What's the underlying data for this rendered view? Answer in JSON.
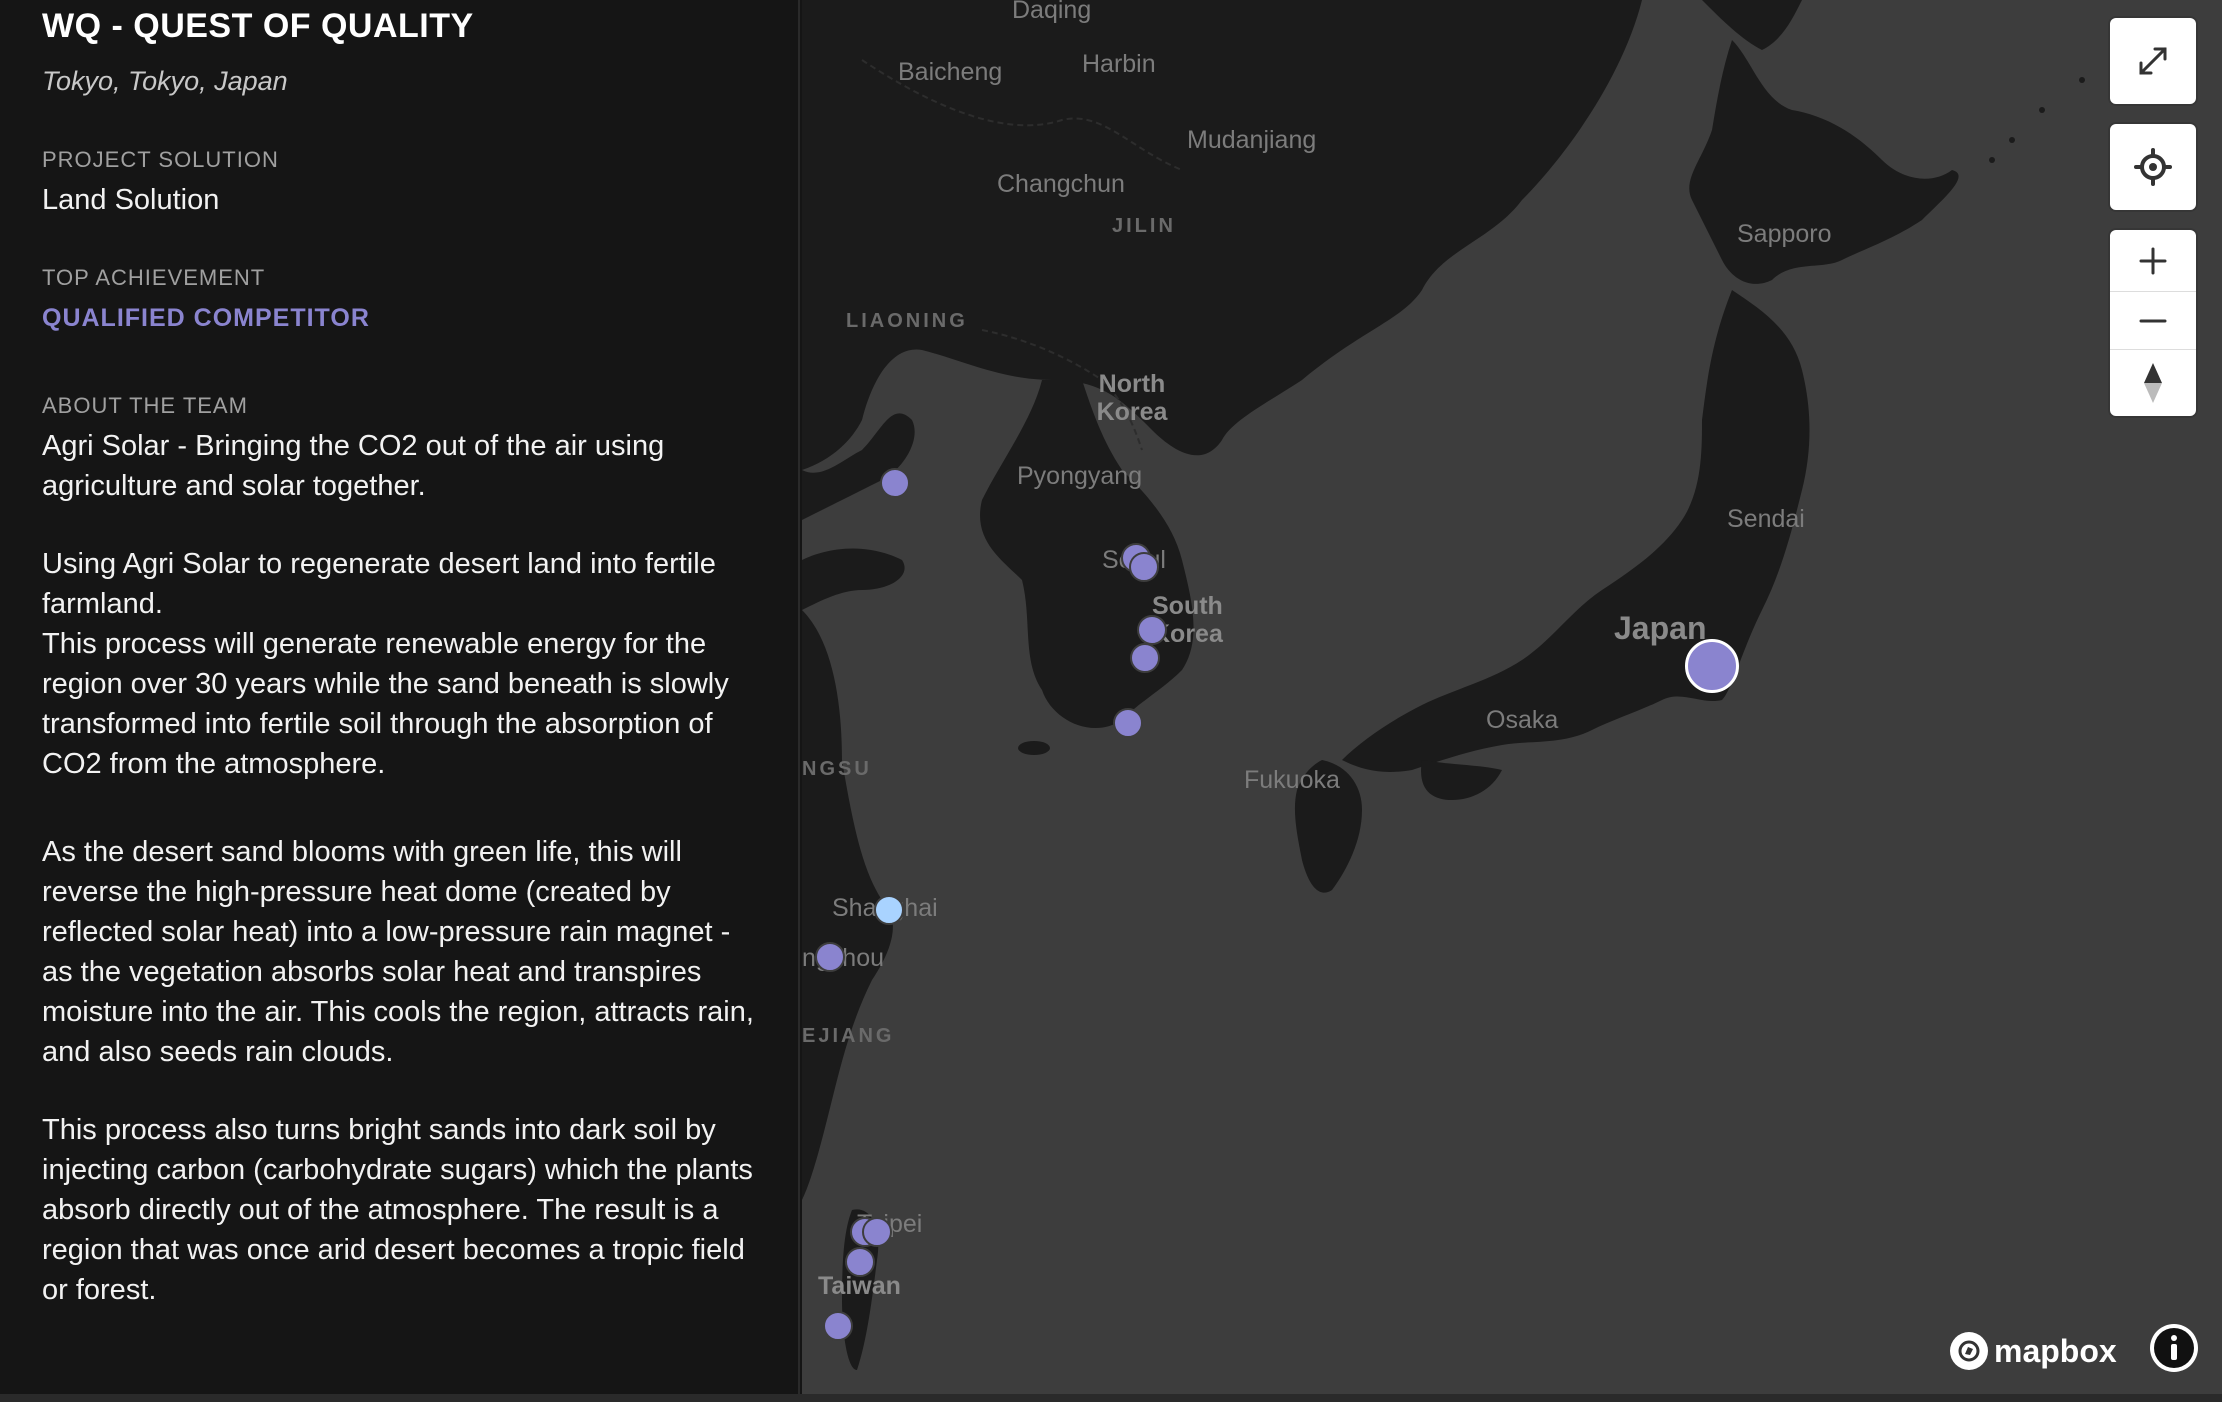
{
  "team": {
    "title": "WQ - QUEST OF QUALITY",
    "location": "Tokyo, Tokyo, Japan"
  },
  "project_solution": {
    "label": "PROJECT SOLUTION",
    "value": "Land Solution"
  },
  "top_achievement": {
    "label": "TOP ACHIEVEMENT",
    "value": "QUALIFIED COMPETITOR"
  },
  "about": {
    "label": "ABOUT THE TEAM",
    "paragraphs": [
      "Agri Solar - Bringing the CO2 out of the air using agriculture and solar together.",
      "Using Agri Solar to regenerate desert land into fertile farmland.",
      "This process will generate renewable energy for the region over 30 years while the sand beneath is slowly transformed into fertile soil through the absorption of CO2 from the atmosphere.",
      "As the desert sand blooms with green life, this will reverse the high-pressure heat dome (created by reflected solar heat) into a low-pressure rain magnet - as the vegetation absorbs solar heat and transpires moisture into the air. This cools the region, attracts rain, and also seeds rain clouds.",
      "This process also turns bright sands into dark soil by injecting carbon (carbohydrate sugars) which the plants absorb directly out of the atmosphere. The result is a region that was once arid desert becomes a tropic field or forest."
    ]
  },
  "map": {
    "places": {
      "daqing": "Daqing",
      "baicheng": "Baicheng",
      "harbin": "Harbin",
      "mudanjiang": "Mudanjiang",
      "changchun": "Changchun",
      "jilin": "JILIN",
      "liaoning": "LIAONING",
      "north_korea": "North Korea",
      "pyongyang": "Pyongyang",
      "seoul": "Seoul",
      "south_korea": "South Korea",
      "sapporo": "Sapporo",
      "sendai": "Sendai",
      "japan": "Japan",
      "osaka": "Osaka",
      "fukuoka": "Fukuoka",
      "jiangsu": "NGSU",
      "shanghai": "Shanghai",
      "hangzhou": "ngzhou",
      "zhejiang": "EJIANG",
      "taipei": "Taipei",
      "taiwan": "Taiwan"
    },
    "attribution": "mapbox",
    "colors": {
      "water": "#3d3d3d",
      "land": "#1b1b1b",
      "marker": "#8a84cf",
      "marker_selected_light": "#a9d3ff"
    }
  },
  "controls": {
    "fullscreen_icon": "expand-arrows-icon",
    "locate_icon": "crosshair-icon",
    "zoom_in_icon": "plus-icon",
    "zoom_out_icon": "minus-icon",
    "compass_icon": "compass-icon",
    "info_icon": "info-icon"
  }
}
